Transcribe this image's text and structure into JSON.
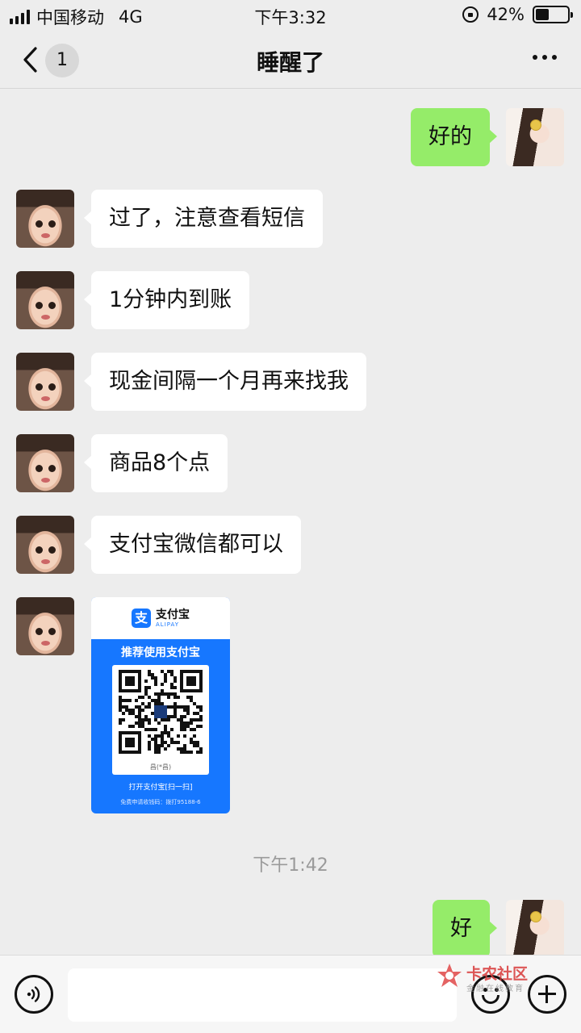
{
  "status_bar": {
    "carrier": "中国移动",
    "network": "4G",
    "time": "下午3:32",
    "battery_percent": "42%",
    "battery_level": 0.42
  },
  "nav": {
    "unread_count": "1",
    "title": "睡醒了"
  },
  "messages": [
    {
      "side": "out",
      "text": "好的"
    },
    {
      "side": "in",
      "text": "过了，注意查看短信"
    },
    {
      "side": "in",
      "text": "1分钟内到账"
    },
    {
      "side": "in",
      "text": "现金间隔一个月再来找我"
    },
    {
      "side": "in",
      "text": "商品8个点"
    },
    {
      "side": "in",
      "text": "支付宝微信都可以"
    },
    {
      "side": "in",
      "type": "image"
    },
    {
      "side": "out",
      "text": "好"
    }
  ],
  "qr_card": {
    "brand_cn": "支付宝",
    "brand_en": "ALIPAY",
    "logo_char": "支",
    "headline": "推荐使用支付宝",
    "owner": "昌(*昌)",
    "hint": "打开支付宝[扫一扫]",
    "sub": "免费申请收钱码：拨打95188-6"
  },
  "timestamp": "下午1:42",
  "watermark": {
    "title": "卡农社区",
    "subtitle": "金融在线教育"
  },
  "icons": [
    "back-chevron-icon",
    "more-dots-icon",
    "voice-icon",
    "emoji-icon",
    "plus-icon"
  ],
  "colors": {
    "background": "#ededed",
    "outgoing_bubble": "#95ec69",
    "incoming_bubble": "#ffffff",
    "alipay_blue": "#1677ff"
  }
}
